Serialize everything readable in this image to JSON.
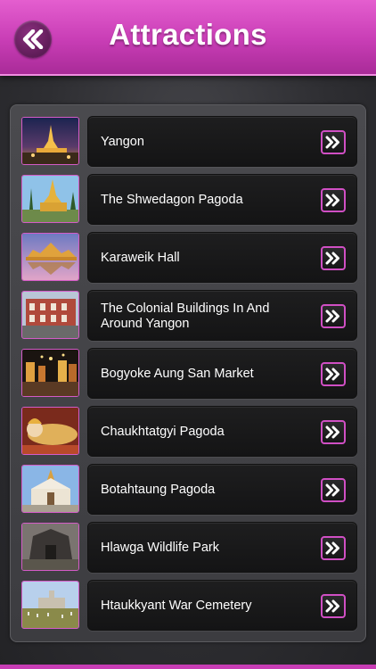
{
  "header": {
    "title": "Attractions",
    "accent_color": "#c83db5",
    "back_icon": "double-chevron-left-icon"
  },
  "attractions": [
    {
      "name": "Yangon",
      "thumb": "golden-pagoda-night"
    },
    {
      "name": "The Shwedagon Pagoda",
      "thumb": "pagoda-spires-daylight"
    },
    {
      "name": "Karaweik Hall",
      "thumb": "barge-hall-reflection"
    },
    {
      "name": "The Colonial Buildings In And Around Yangon",
      "thumb": "colonial-building-street"
    },
    {
      "name": "Bogyoke Aung San Market",
      "thumb": "night-market-street"
    },
    {
      "name": "Chaukhtatgyi Pagoda",
      "thumb": "reclining-buddha"
    },
    {
      "name": "Botahtaung Pagoda",
      "thumb": "white-pagoda-entrance"
    },
    {
      "name": "Hlawga Wildlife Park",
      "thumb": "dark-stone-structure"
    },
    {
      "name": "Htaukkyant War Cemetery",
      "thumb": "cemetery-field"
    }
  ],
  "row_button_icon": "double-chevron-right-icon"
}
